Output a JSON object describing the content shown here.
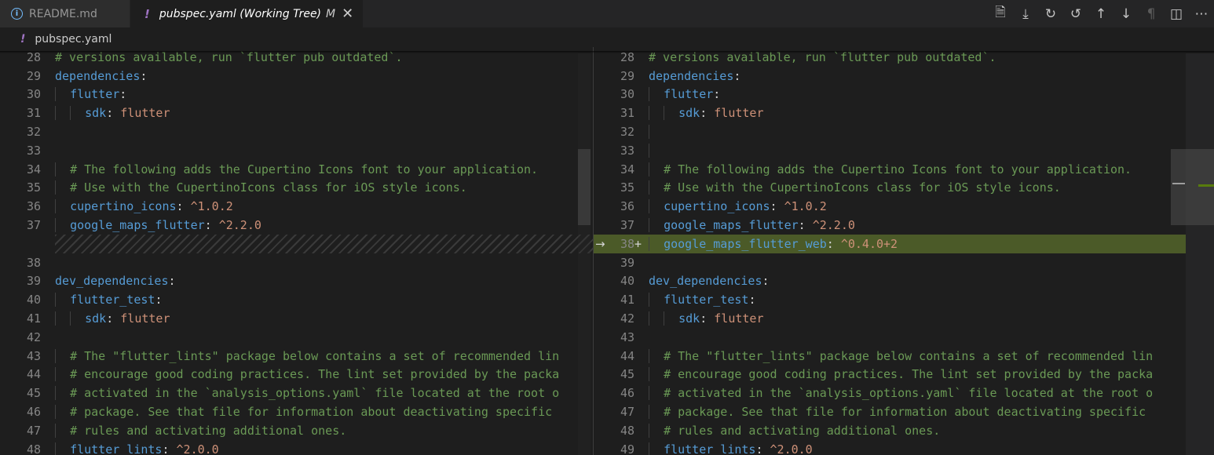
{
  "tabs": [
    {
      "icon": "info-icon",
      "label": "README.md",
      "active": false
    },
    {
      "icon": "yaml-icon",
      "label": "pubspec.yaml (Working Tree)",
      "modified": "M",
      "active": true
    }
  ],
  "breadcrumb": {
    "icon": "yaml-icon",
    "label": "pubspec.yaml"
  },
  "toolbar": [
    "open-file-icon",
    "pull-icon",
    "sync-icon",
    "history-icon",
    "arrow-up-icon",
    "arrow-down-icon",
    "pilcrow-icon",
    "split-editor-icon",
    "more-icon"
  ],
  "colors": {
    "added_line": "#4b5a28",
    "key": "#569cd6",
    "value": "#ce9178",
    "comment": "#6a9955"
  },
  "left_lines": [
    {
      "n": "28",
      "ind": 0,
      "parts": [
        [
          "c",
          "# versions available, run `flutter pub outdated`."
        ]
      ]
    },
    {
      "n": "29",
      "ind": 0,
      "parts": [
        [
          "k",
          "dependencies"
        ],
        [
          "p",
          ":"
        ]
      ]
    },
    {
      "n": "30",
      "ind": 1,
      "parts": [
        [
          "k",
          "flutter"
        ],
        [
          "p",
          ":"
        ]
      ]
    },
    {
      "n": "31",
      "ind": 2,
      "parts": [
        [
          "k",
          "sdk"
        ],
        [
          "p",
          ": "
        ],
        [
          "v",
          "flutter"
        ]
      ]
    },
    {
      "n": "32",
      "ind": 0,
      "parts": []
    },
    {
      "n": "33",
      "ind": 0,
      "parts": []
    },
    {
      "n": "34",
      "ind": 1,
      "parts": [
        [
          "c",
          "# The following adds the Cupertino Icons font to your application."
        ]
      ]
    },
    {
      "n": "35",
      "ind": 1,
      "parts": [
        [
          "c",
          "# Use with the CupertinoIcons class for iOS style icons."
        ]
      ]
    },
    {
      "n": "36",
      "ind": 1,
      "parts": [
        [
          "k",
          "cupertino_icons"
        ],
        [
          "p",
          ": "
        ],
        [
          "v",
          "^1.0.2"
        ]
      ]
    },
    {
      "n": "37",
      "ind": 1,
      "parts": [
        [
          "k",
          "google_maps_flutter"
        ],
        [
          "p",
          ": "
        ],
        [
          "v",
          "^2.2.0"
        ]
      ]
    },
    {
      "n": "",
      "hatch": true,
      "parts": []
    },
    {
      "n": "38",
      "ind": 0,
      "parts": []
    },
    {
      "n": "39",
      "ind": 0,
      "parts": [
        [
          "k",
          "dev_dependencies"
        ],
        [
          "p",
          ":"
        ]
      ]
    },
    {
      "n": "40",
      "ind": 1,
      "parts": [
        [
          "k",
          "flutter_test"
        ],
        [
          "p",
          ":"
        ]
      ]
    },
    {
      "n": "41",
      "ind": 2,
      "parts": [
        [
          "k",
          "sdk"
        ],
        [
          "p",
          ": "
        ],
        [
          "v",
          "flutter"
        ]
      ]
    },
    {
      "n": "42",
      "ind": 0,
      "parts": []
    },
    {
      "n": "43",
      "ind": 1,
      "parts": [
        [
          "c",
          "# The \"flutter_lints\" package below contains a set of recommended lin"
        ]
      ]
    },
    {
      "n": "44",
      "ind": 1,
      "parts": [
        [
          "c",
          "# encourage good coding practices. The lint set provided by the packa"
        ]
      ]
    },
    {
      "n": "45",
      "ind": 1,
      "parts": [
        [
          "c",
          "# activated in the `analysis_options.yaml` file located at the root o"
        ]
      ]
    },
    {
      "n": "46",
      "ind": 1,
      "parts": [
        [
          "c",
          "# package. See that file for information about deactivating specific"
        ]
      ]
    },
    {
      "n": "47",
      "ind": 1,
      "parts": [
        [
          "c",
          "# rules and activating additional ones."
        ]
      ]
    },
    {
      "n": "48",
      "ind": 1,
      "parts": [
        [
          "k",
          "flutter_lints"
        ],
        [
          "p",
          ": "
        ],
        [
          "v",
          "^2.0.0"
        ]
      ]
    }
  ],
  "right_lines": [
    {
      "n": "28",
      "ind": 0,
      "parts": [
        [
          "c",
          "# versions available, run `flutter pub outdated`."
        ]
      ]
    },
    {
      "n": "29",
      "ind": 0,
      "parts": [
        [
          "k",
          "dependencies"
        ],
        [
          "p",
          ":"
        ]
      ]
    },
    {
      "n": "30",
      "ind": 1,
      "parts": [
        [
          "k",
          "flutter"
        ],
        [
          "p",
          ":"
        ]
      ]
    },
    {
      "n": "31",
      "ind": 2,
      "parts": [
        [
          "k",
          "sdk"
        ],
        [
          "p",
          ": "
        ],
        [
          "v",
          "flutter"
        ]
      ]
    },
    {
      "n": "32",
      "ind": 1,
      "parts": []
    },
    {
      "n": "33",
      "ind": 1,
      "parts": []
    },
    {
      "n": "34",
      "ind": 1,
      "parts": [
        [
          "c",
          "# The following adds the Cupertino Icons font to your application."
        ]
      ]
    },
    {
      "n": "35",
      "ind": 1,
      "parts": [
        [
          "c",
          "# Use with the CupertinoIcons class for iOS style icons."
        ]
      ]
    },
    {
      "n": "36",
      "ind": 1,
      "parts": [
        [
          "k",
          "cupertino_icons"
        ],
        [
          "p",
          ": "
        ],
        [
          "v",
          "^1.0.2"
        ]
      ]
    },
    {
      "n": "37",
      "ind": 1,
      "parts": [
        [
          "k",
          "google_maps_flutter"
        ],
        [
          "p",
          ": "
        ],
        [
          "v",
          "^2.2.0"
        ]
      ]
    },
    {
      "n": "38",
      "ind": 1,
      "added": true,
      "marker": "+",
      "arrow": "→",
      "parts": [
        [
          "k",
          "google_maps_flutter_web"
        ],
        [
          "p",
          ": "
        ],
        [
          "v",
          "^0.4.0+2"
        ]
      ]
    },
    {
      "n": "39",
      "ind": 0,
      "parts": []
    },
    {
      "n": "40",
      "ind": 0,
      "parts": [
        [
          "k",
          "dev_dependencies"
        ],
        [
          "p",
          ":"
        ]
      ]
    },
    {
      "n": "41",
      "ind": 1,
      "parts": [
        [
          "k",
          "flutter_test"
        ],
        [
          "p",
          ":"
        ]
      ]
    },
    {
      "n": "42",
      "ind": 2,
      "parts": [
        [
          "k",
          "sdk"
        ],
        [
          "p",
          ": "
        ],
        [
          "v",
          "flutter"
        ]
      ]
    },
    {
      "n": "43",
      "ind": 0,
      "parts": []
    },
    {
      "n": "44",
      "ind": 1,
      "parts": [
        [
          "c",
          "# The \"flutter_lints\" package below contains a set of recommended lin"
        ]
      ]
    },
    {
      "n": "45",
      "ind": 1,
      "parts": [
        [
          "c",
          "# encourage good coding practices. The lint set provided by the packa"
        ]
      ]
    },
    {
      "n": "46",
      "ind": 1,
      "parts": [
        [
          "c",
          "# activated in the `analysis_options.yaml` file located at the root o"
        ]
      ]
    },
    {
      "n": "47",
      "ind": 1,
      "parts": [
        [
          "c",
          "# package. See that file for information about deactivating specific"
        ]
      ]
    },
    {
      "n": "48",
      "ind": 1,
      "parts": [
        [
          "c",
          "# rules and activating additional ones."
        ]
      ]
    },
    {
      "n": "49",
      "ind": 1,
      "parts": [
        [
          "k",
          "flutter_lints"
        ],
        [
          "p",
          ": "
        ],
        [
          "v",
          "^2.0.0"
        ]
      ]
    }
  ]
}
